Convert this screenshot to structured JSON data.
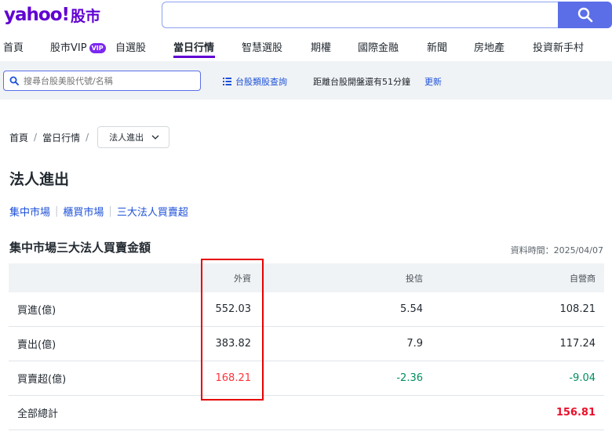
{
  "header": {
    "logo_text": "yahoo!",
    "logo_sub": "股市",
    "search_value": "",
    "search_icon": "search-icon"
  },
  "nav": {
    "items": [
      "首頁",
      "股市VIP",
      "自選股",
      "當日行情",
      "智慧選股",
      "期權",
      "國際金融",
      "新聞",
      "房地產",
      "投資新手村"
    ],
    "vip_badge": "VIP",
    "active": "當日行情",
    "accent_color": "#6001d2"
  },
  "subbar": {
    "search_placeholder": "搜尋台股美股代號/名稱",
    "category_link": "台股類股查詢",
    "market_status": "距離台股開盤還有51分鐘",
    "refresh": "更新"
  },
  "breadcrumb": {
    "home": "首頁",
    "daily": "當日行情",
    "current": "法人進出"
  },
  "page_title": "法人進出",
  "market_tabs": [
    "集中市場",
    "櫃買市場",
    "三大法人買賣超"
  ],
  "section": {
    "title": "集中市場三大法人買賣金額",
    "data_time": "資料時間：2025/04/07"
  },
  "table": {
    "headers": [
      "",
      "外資",
      "投信",
      "自營商"
    ],
    "rows": [
      {
        "label": "買進(億)",
        "foreign": "552.03",
        "trust": "5.54",
        "dealer": "108.21"
      },
      {
        "label": "賣出(億)",
        "foreign": "383.82",
        "trust": "7.9",
        "dealer": "117.24"
      },
      {
        "label": "買賣超(億)",
        "foreign": "168.21",
        "trust": "-2.36",
        "dealer": "-9.04"
      }
    ],
    "total_label": "全部總計",
    "total_value": "156.81"
  },
  "colors": {
    "up": "#ff333a",
    "down": "#008f5d",
    "highlight_box": "#e60000",
    "link": "#1d51d8"
  }
}
